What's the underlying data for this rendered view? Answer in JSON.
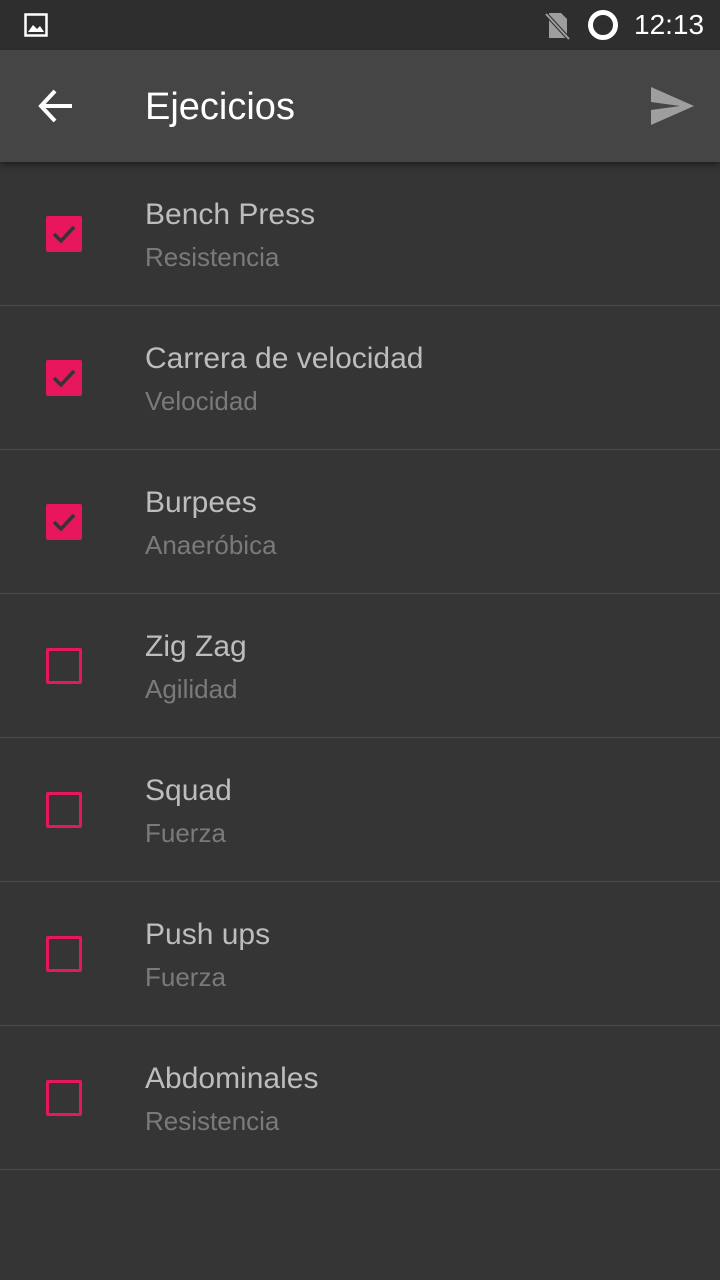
{
  "status_bar": {
    "time": "12:13",
    "icons": [
      "gallery-icon",
      "no-sim-icon",
      "sync-ring-icon"
    ]
  },
  "app_bar": {
    "title": "Ejecicios",
    "back_icon": "arrow-left-icon",
    "send_icon": "send-icon"
  },
  "accent_color": "#e8175d",
  "exercises": [
    {
      "name": "Bench Press",
      "category": "Resistencia",
      "checked": true
    },
    {
      "name": "Carrera de velocidad",
      "category": "Velocidad",
      "checked": true
    },
    {
      "name": "Burpees",
      "category": "Anaeróbica",
      "checked": true
    },
    {
      "name": "Zig Zag",
      "category": "Agilidad",
      "checked": false
    },
    {
      "name": "Squad",
      "category": "Fuerza",
      "checked": false
    },
    {
      "name": "Push ups",
      "category": "Fuerza",
      "checked": false
    },
    {
      "name": "Abdominales",
      "category": "Resistencia",
      "checked": false
    }
  ]
}
